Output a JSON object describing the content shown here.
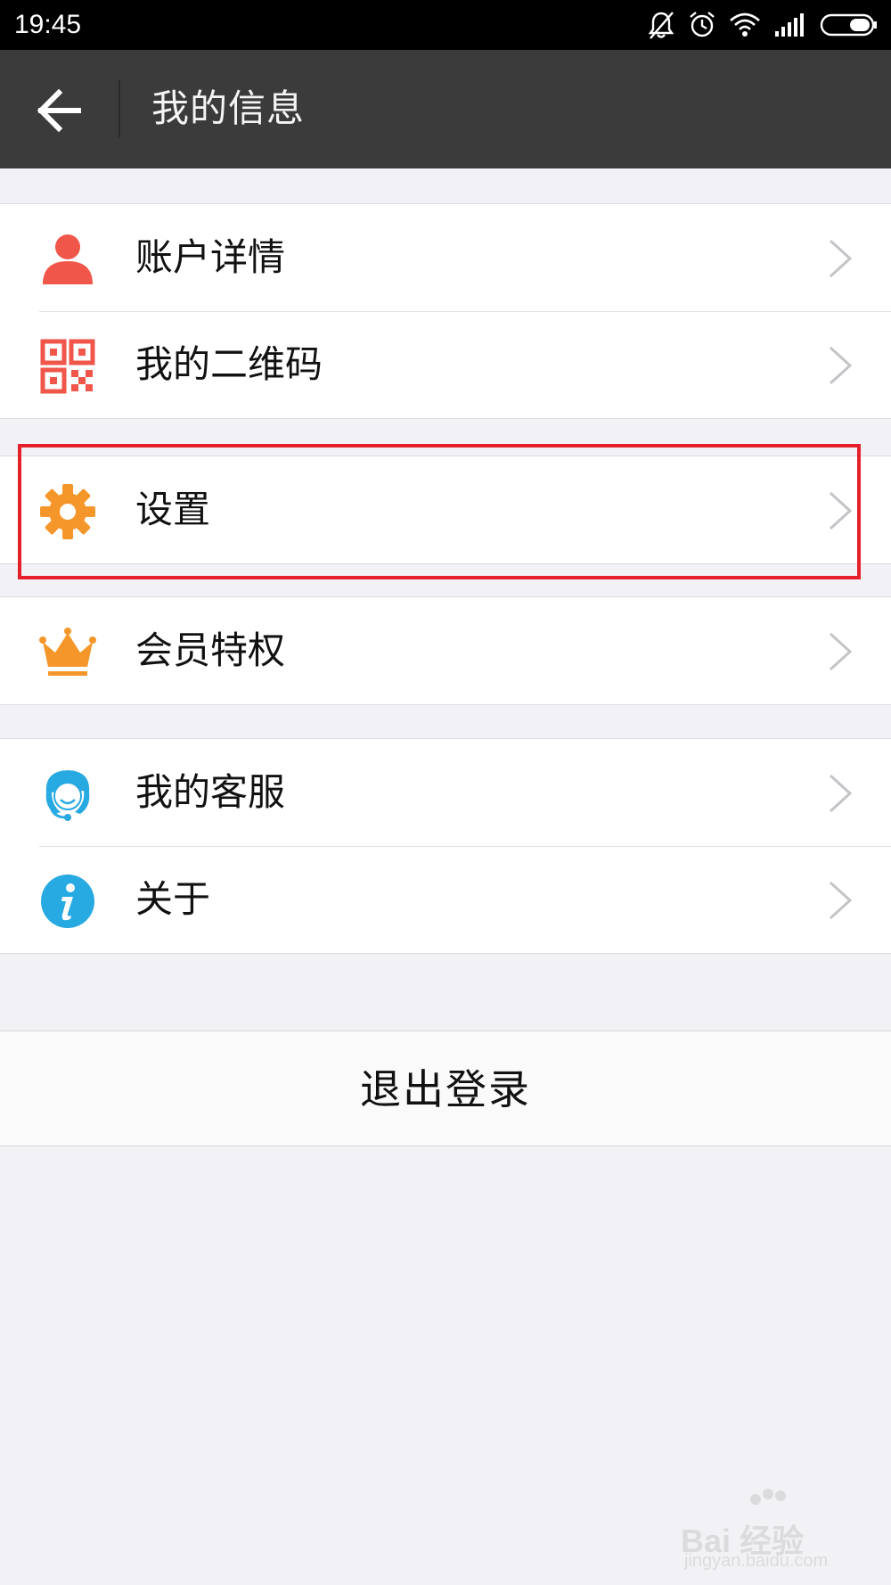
{
  "status_bar": {
    "time": "19:45",
    "icons": [
      "bell-muted-icon",
      "alarm-icon",
      "wifi-icon",
      "signal-icon",
      "battery-icon"
    ]
  },
  "app_bar": {
    "back_icon": "arrow-left-icon",
    "title": "我的信息"
  },
  "menu": {
    "groups": [
      {
        "items": [
          {
            "label": "账户详情",
            "icon": "user-icon",
            "icon_color": "#f0564a"
          },
          {
            "label": "我的二维码",
            "icon": "qr-code-icon",
            "icon_color": "#f0564a"
          }
        ]
      },
      {
        "items": [
          {
            "label": "设置",
            "icon": "gear-icon",
            "icon_color": "#f5962a",
            "highlighted": true
          }
        ]
      },
      {
        "items": [
          {
            "label": "会员特权",
            "icon": "crown-icon",
            "icon_color": "#f5962a"
          }
        ]
      },
      {
        "items": [
          {
            "label": "我的客服",
            "icon": "customer-service-icon",
            "icon_color": "#27a9e1"
          },
          {
            "label": "关于",
            "icon": "info-icon",
            "icon_color": "#27a9e1"
          }
        ]
      }
    ]
  },
  "highlight_color": "#e5202a",
  "logout": {
    "label": "退出登录"
  },
  "watermark": {
    "text": "Bai 经验",
    "sub": "jingyan.baidu.com"
  }
}
